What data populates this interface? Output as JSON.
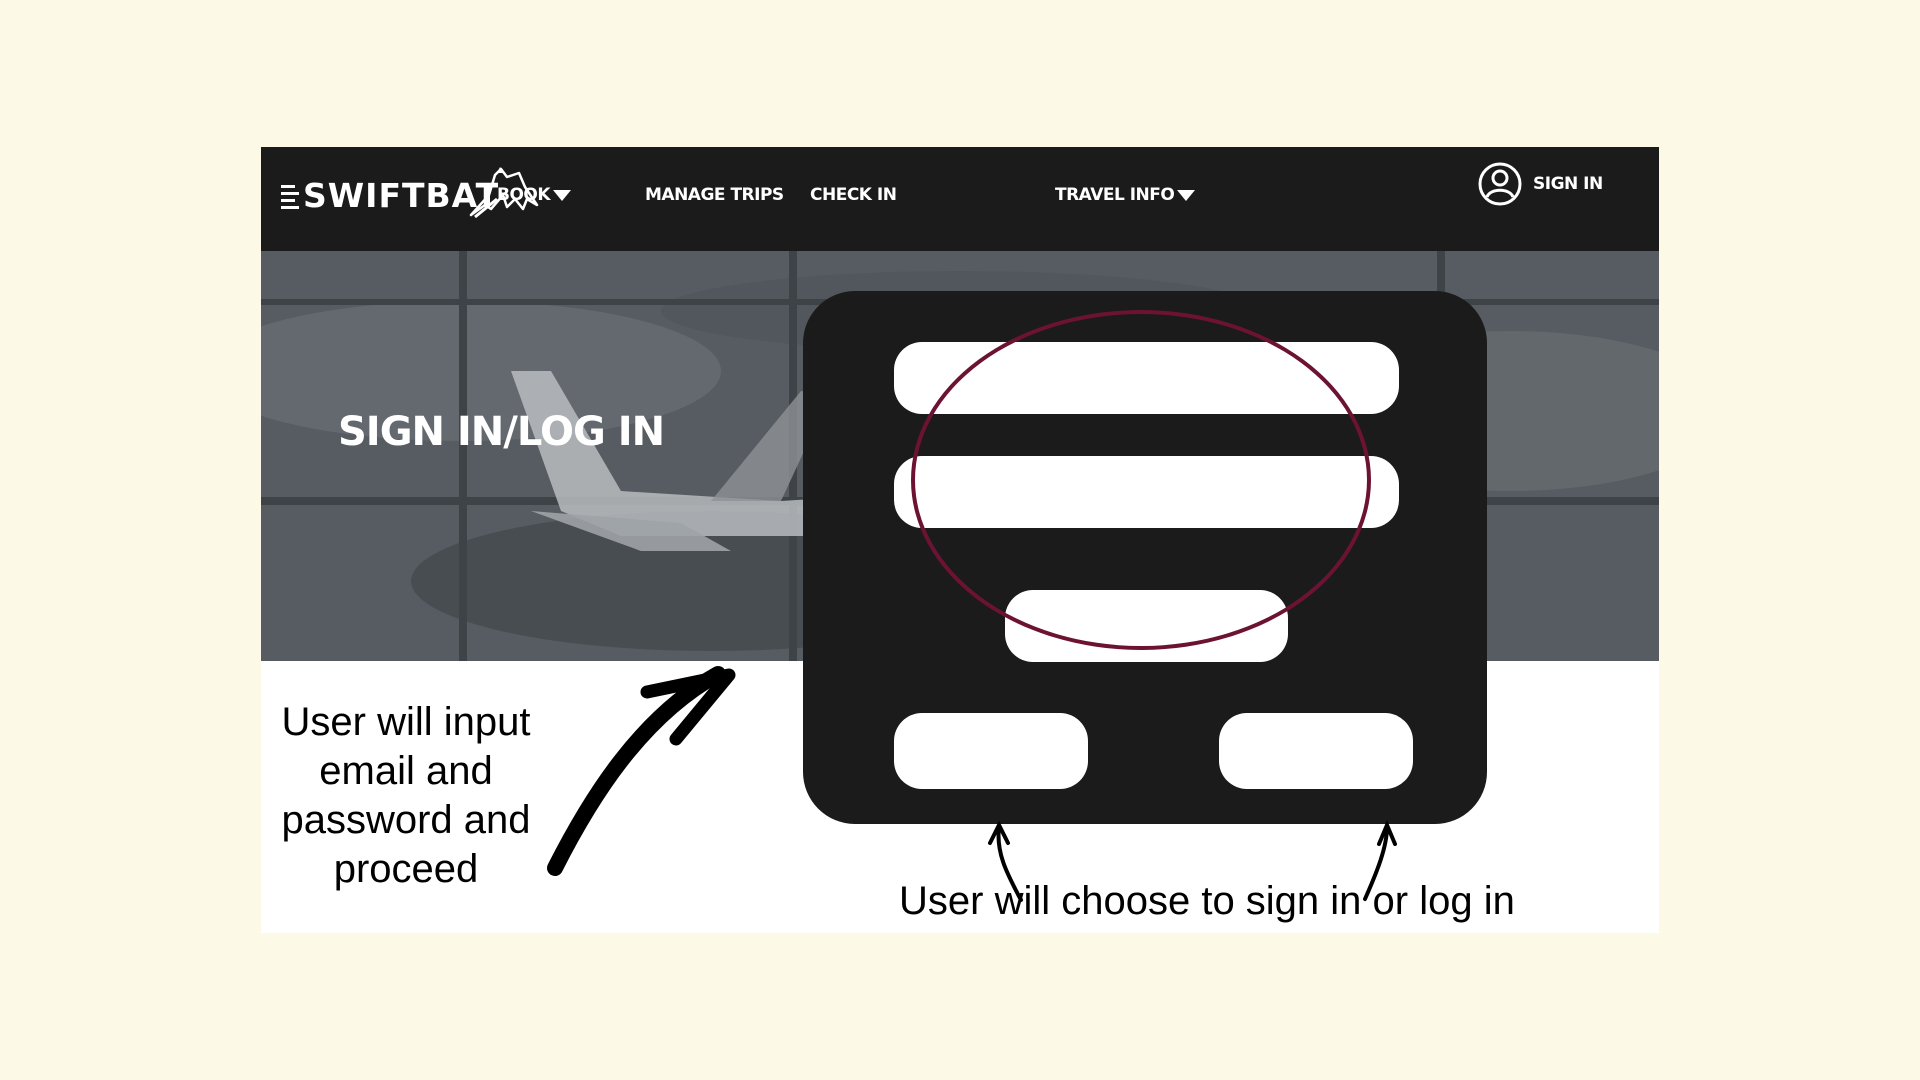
{
  "brand": {
    "logo_text": "SWIFTBAT"
  },
  "nav": {
    "items": [
      {
        "label": "BOOK"
      },
      {
        "label": "MANAGE TRIPS"
      },
      {
        "label": "CHECK IN"
      },
      {
        "label": "TRAVEL INFO"
      }
    ],
    "sign_in_label": "SIGN IN"
  },
  "hero": {
    "title": "SIGN IN/LOG IN"
  },
  "annotations": {
    "left_note": "User will input email and password and proceed",
    "bottom_note": "User will choose to sign in or log in"
  },
  "colors": {
    "background": "#fcf9e6",
    "navbar": "#1b1b1b",
    "panel": "#1b1b1b",
    "highlight_oval": "#6c1333"
  },
  "icons": {
    "account": "user-circle-icon",
    "dropdown": "caret-down-icon",
    "logo_mark": "bat-icon"
  }
}
